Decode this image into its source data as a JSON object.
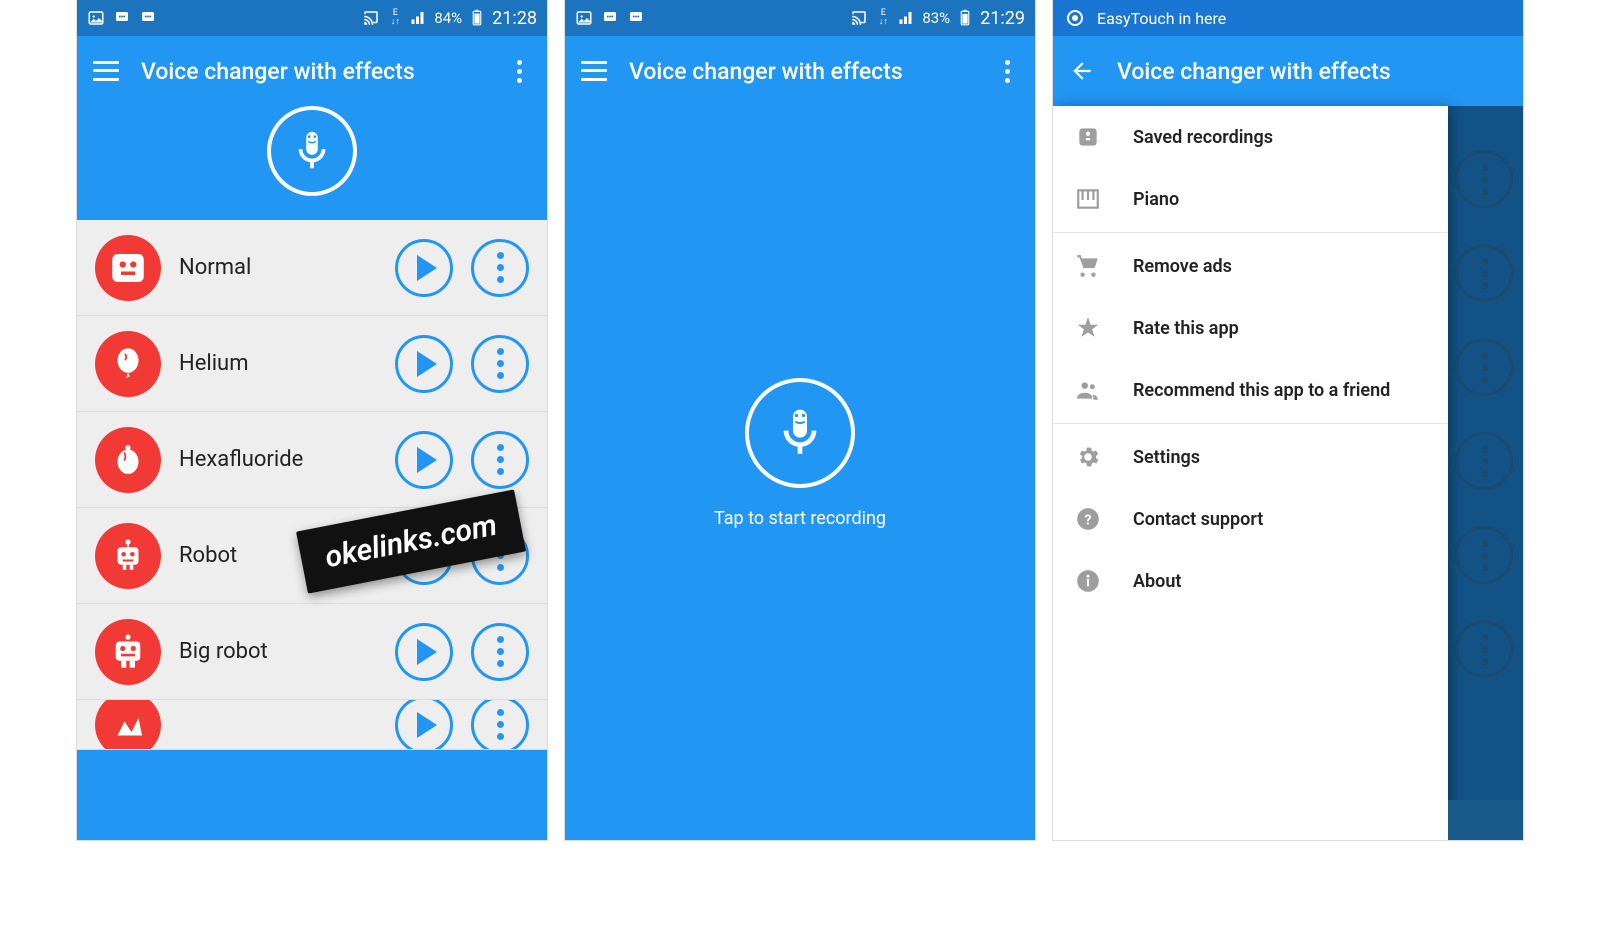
{
  "app_title": "Voice changer with effects",
  "statusbar1": {
    "battery": "84%",
    "time": "21:28"
  },
  "statusbar2": {
    "battery": "83%",
    "time": "21:29"
  },
  "screen1": {
    "effects": [
      {
        "name": "Normal"
      },
      {
        "name": "Helium"
      },
      {
        "name": "Hexafluoride"
      },
      {
        "name": "Robot"
      },
      {
        "name": "Big robot"
      }
    ]
  },
  "screen2": {
    "tap_text": "Tap to start recording"
  },
  "screen3": {
    "easytouch": "EasyTouch in here",
    "menu": [
      "Saved recordings",
      "Piano",
      "Remove ads",
      "Rate this app",
      "Recommend this app to a friend",
      "Settings",
      "Contact support",
      "About"
    ]
  },
  "watermark": "okelinks.com"
}
